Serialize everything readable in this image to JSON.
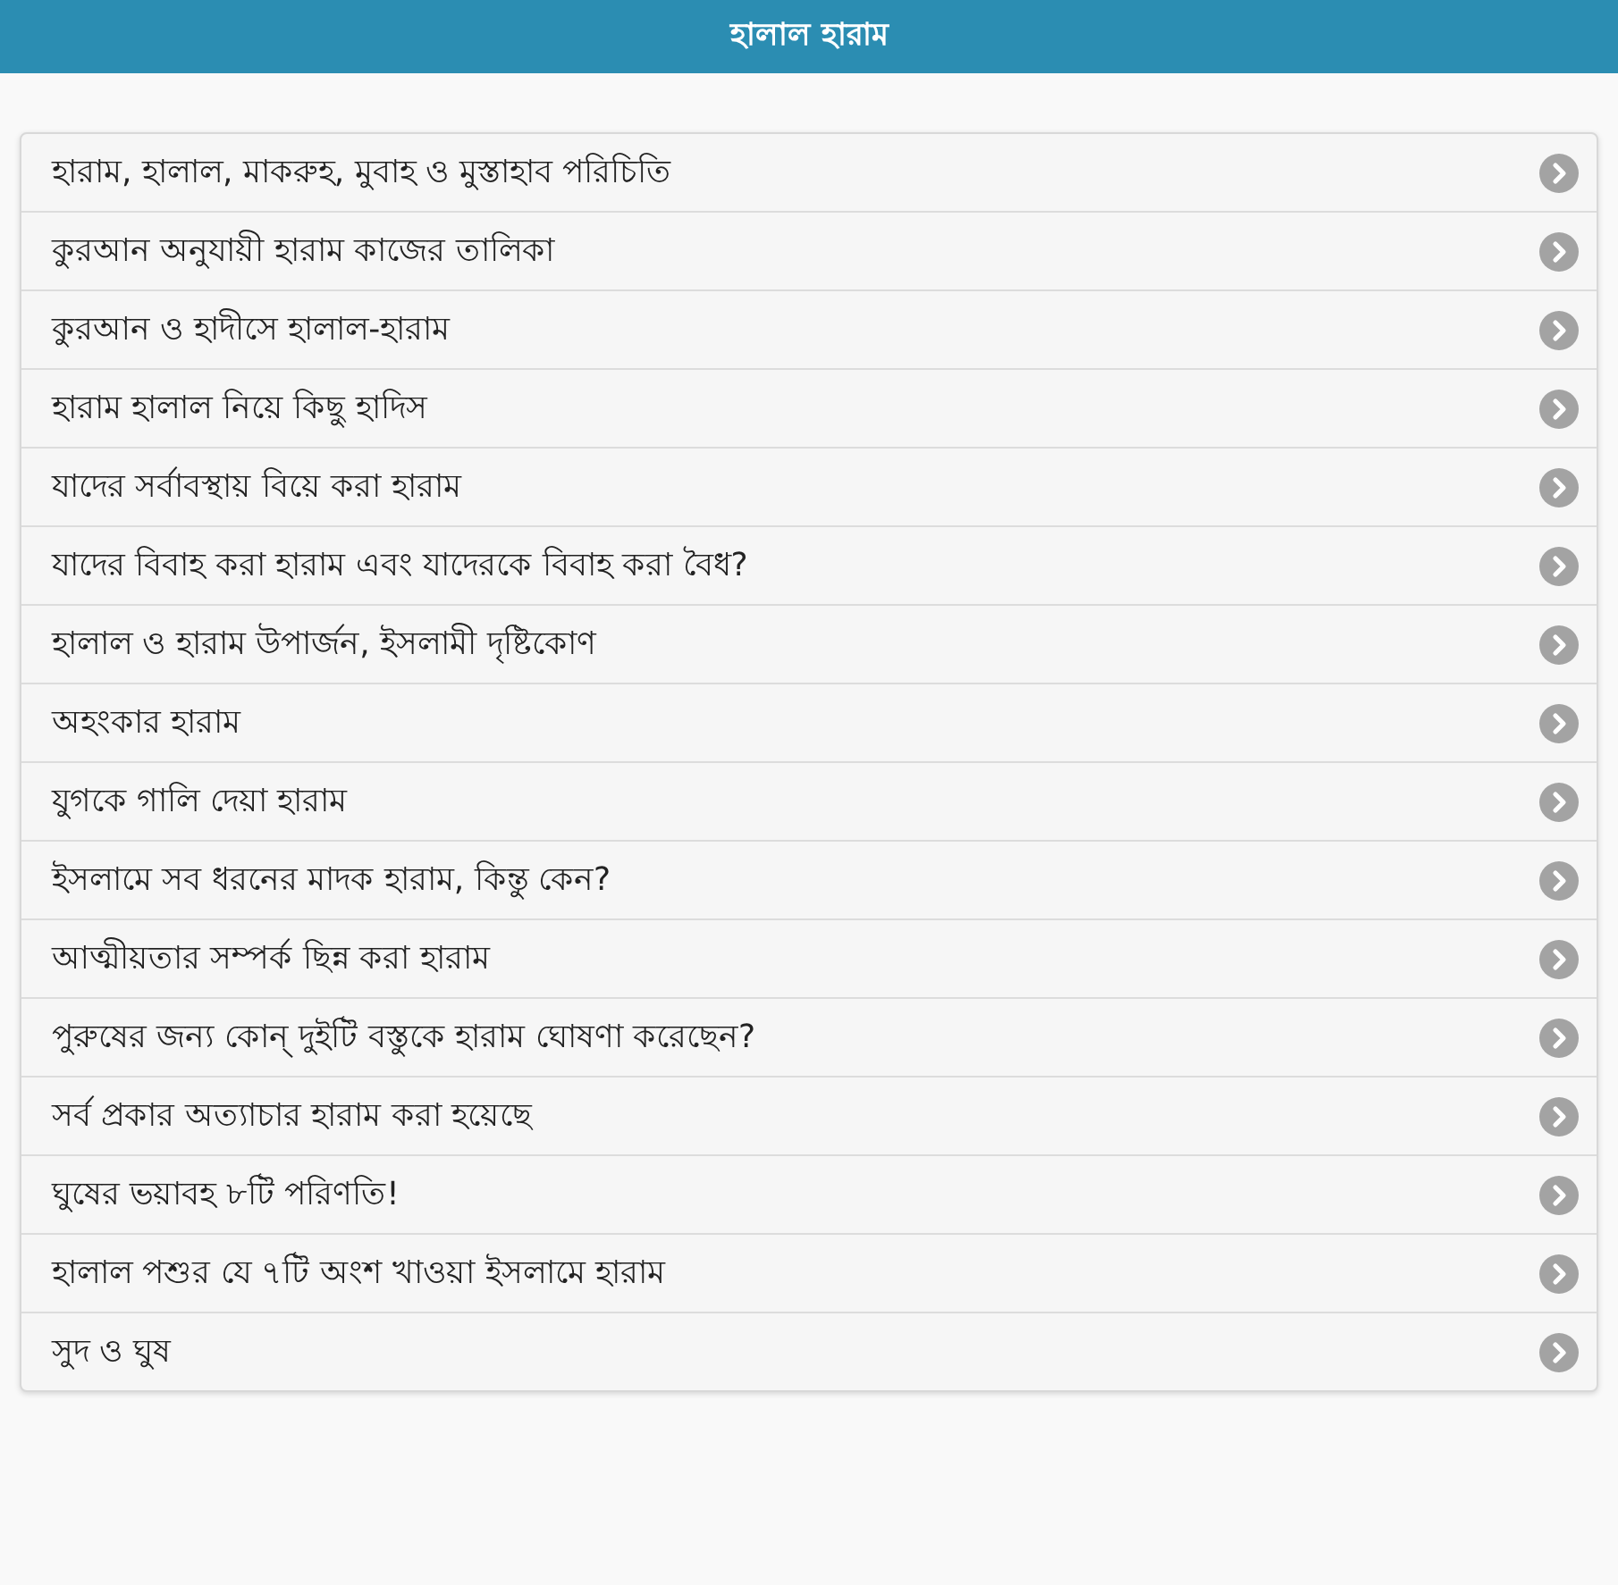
{
  "header": {
    "title": "হালাল হারাম"
  },
  "items": [
    "হারাম, হালাল, মাকরুহ, মুবাহ ও মুস্তাহাব পরিচিতি",
    "কুরআন অনুযায়ী হারাম কাজের তালিকা",
    "কুরআন ও হাদীসে হালাল-হারাম",
    "হারাম হালাল নিয়ে কিছু হাদিস",
    "যাদের সর্বাবস্থায় বিয়ে করা হারাম",
    "যাদের বিবাহ করা হারাম এবং যাদেরকে বিবাহ করা বৈধ?",
    "হালাল ও হারাম উপার্জন, ইসলামী দৃষ্টিকোণ",
    "অহংকার হারাম",
    "যুগকে গালি দেয়া হারাম",
    "ইসলামে সব ধরনের মাদক হারাম, কিন্তু কেন?",
    "আত্মীয়তার সম্পর্ক ছিন্ন করা হারাম",
    "পুরুষের জন্য কোন্ দুইটি বস্তুকে হারাম ঘোষণা করেছেন?",
    "সর্ব প্রকার অত্যাচার হারাম করা হয়েছে",
    "ঘুষের ভয়াবহ ৮টি পরিণতি!",
    "হালাল পশুর যে ৭টি অংশ খাওয়া ইসলামে হারাম",
    "সুদ ও ঘুষ"
  ]
}
